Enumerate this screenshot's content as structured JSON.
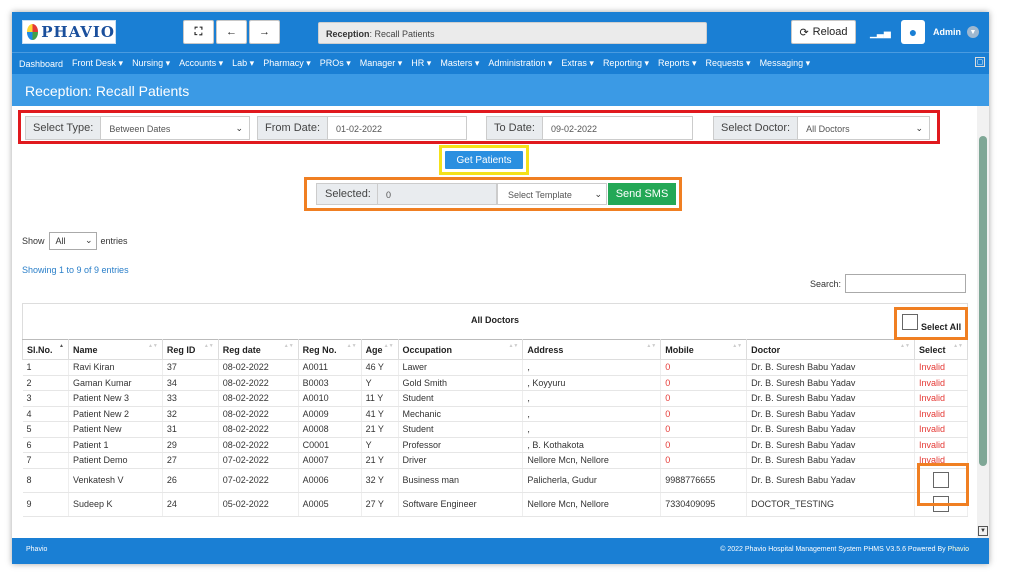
{
  "app": {
    "logo_text": "PHAVIO"
  },
  "toolbar": {
    "expand_icon": "⛶",
    "back_icon": "←",
    "forward_icon": "→",
    "breadcrumb_section": "Reception",
    "breadcrumb_page": "Recall Patients",
    "reload_label": "Reload",
    "user_name": "Admin"
  },
  "nav": [
    "Dashboard",
    "Front Desk ▾",
    "Nursing ▾",
    "Accounts ▾",
    "Lab ▾",
    "Pharmacy ▾",
    "PROs ▾",
    "Manager ▾",
    "HR ▾",
    "Masters ▾",
    "Administration ▾",
    "Extras ▾",
    "Reporting ▾",
    "Reports ▾",
    "Requests ▾",
    "Messaging ▾"
  ],
  "page_title": "Reception: Recall Patients",
  "filters": {
    "select_type_label": "Select Type:",
    "select_type_value": "Between Dates",
    "from_date_label": "From Date:",
    "from_date_value": "01-02-2022",
    "to_date_label": "To Date:",
    "to_date_value": "09-02-2022",
    "doctor_label": "Select Doctor:",
    "doctor_value": "All Doctors"
  },
  "get_patients_label": "Get Patients",
  "sms": {
    "selected_label": "Selected:",
    "selected_value": "0",
    "template_placeholder": "Select Template",
    "send_label": "Send SMS"
  },
  "entries": {
    "show_label": "Show",
    "show_value": "All",
    "entries_label": "entries"
  },
  "showing_text": "Showing 1 to 9 of 9 entries",
  "search_label": "Search:",
  "table": {
    "caption": "All Doctors",
    "select_all_label": "Select All",
    "columns": [
      "Sl.No.",
      "Name",
      "Reg ID",
      "Reg date",
      "Reg No.",
      "Age",
      "Occupation",
      "Address",
      "Mobile",
      "Doctor",
      "Select"
    ],
    "rows": [
      [
        "1",
        "Ravi Kiran",
        "37",
        "08-02-2022",
        "A0011",
        "46 Y",
        "Lawer",
        ",",
        "0",
        "Dr. B. Suresh Babu Yadav",
        "Invalid"
      ],
      [
        "2",
        "Gaman Kumar",
        "34",
        "08-02-2022",
        "B0003",
        "Y",
        "Gold Smith",
        ", Koyyuru",
        "0",
        "Dr. B. Suresh Babu Yadav",
        "Invalid"
      ],
      [
        "3",
        "Patient New 3",
        "33",
        "08-02-2022",
        "A0010",
        "11 Y",
        "Student",
        ",",
        "0",
        "Dr. B. Suresh Babu Yadav",
        "Invalid"
      ],
      [
        "4",
        "Patient New 2",
        "32",
        "08-02-2022",
        "A0009",
        "41 Y",
        "Mechanic",
        ",",
        "0",
        "Dr. B. Suresh Babu Yadav",
        "Invalid"
      ],
      [
        "5",
        "Patient New",
        "31",
        "08-02-2022",
        "A0008",
        "21 Y",
        "Student",
        ",",
        "0",
        "Dr. B. Suresh Babu Yadav",
        "Invalid"
      ],
      [
        "6",
        "Patient 1",
        "29",
        "08-02-2022",
        "C0001",
        "Y",
        "Professor",
        ", B. Kothakota",
        "0",
        "Dr. B. Suresh Babu Yadav",
        "Invalid"
      ],
      [
        "7",
        "Patient Demo",
        "27",
        "07-02-2022",
        "A0007",
        "21 Y",
        "Driver",
        "Nellore Mcn, Nellore",
        "0",
        "Dr. B. Suresh Babu Yadav",
        "Invalid"
      ],
      [
        "8",
        "Venkatesh V",
        "26",
        "07-02-2022",
        "A0006",
        "32 Y",
        "Business man",
        "Palicherla, Gudur",
        "9988776655",
        "Dr. B. Suresh Babu Yadav",
        ""
      ],
      [
        "9",
        "Sudeep K",
        "24",
        "05-02-2022",
        "A0005",
        "27 Y",
        "Software Engineer",
        "Nellore Mcn, Nellore",
        "7330409095",
        "DOCTOR_TESTING",
        ""
      ]
    ]
  },
  "footer": {
    "left": "Phavio",
    "right": "© 2022 Phavio Hospital Management System PHMS V3.5.6 Powered By ",
    "right_brand": "Phavio"
  },
  "colors": {
    "primary": "#1a7fd4",
    "header_light": "#3b9ae5",
    "sms_green": "#23a856",
    "invalid_red": "#e53935",
    "highlight_red": "#e0191e",
    "highlight_yellow": "#f4e11a",
    "highlight_orange": "#f07f22"
  }
}
